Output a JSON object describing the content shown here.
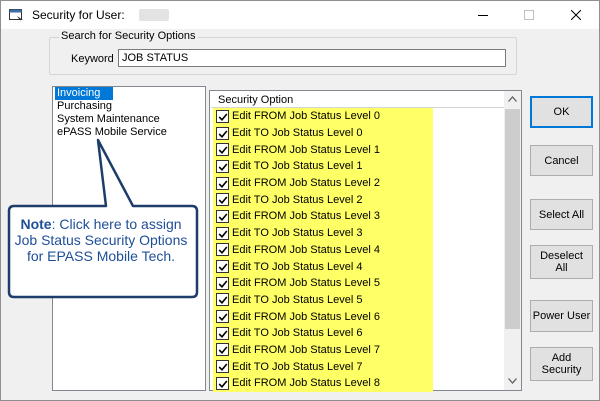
{
  "window": {
    "title": "Security for User:",
    "icon": "app-window-icon"
  },
  "search": {
    "group_label": "Search for Security Options",
    "keyword_label": "Keyword",
    "keyword_value": "JOB STATUS"
  },
  "modules": [
    {
      "label": "Invoicing",
      "selected": true
    },
    {
      "label": "Purchasing",
      "selected": false
    },
    {
      "label": "System Maintenance",
      "selected": false
    },
    {
      "label": "ePASS Mobile Service",
      "selected": false
    }
  ],
  "options": {
    "header": "Security Option",
    "highlight_color": "#ffff66",
    "rows": [
      {
        "label": "Edit FROM Job Status Level 0",
        "checked": true
      },
      {
        "label": "Edit TO Job Status Level 0",
        "checked": true
      },
      {
        "label": "Edit FROM Job Status Level 1",
        "checked": true
      },
      {
        "label": "Edit TO Job Status Level 1",
        "checked": true
      },
      {
        "label": "Edit FROM Job Status Level 2",
        "checked": true
      },
      {
        "label": "Edit TO Job Status Level 2",
        "checked": true
      },
      {
        "label": "Edit FROM Job Status Level 3",
        "checked": true
      },
      {
        "label": "Edit TO Job Status Level 3",
        "checked": true
      },
      {
        "label": "Edit FROM Job Status Level 4",
        "checked": true
      },
      {
        "label": "Edit TO Job Status Level 4",
        "checked": true
      },
      {
        "label": "Edit FROM Job Status Level 5",
        "checked": true
      },
      {
        "label": "Edit TO Job Status Level 5",
        "checked": true
      },
      {
        "label": "Edit FROM Job Status Level 6",
        "checked": true
      },
      {
        "label": "Edit TO Job Status Level 6",
        "checked": true
      },
      {
        "label": "Edit FROM Job Status Level 7",
        "checked": true
      },
      {
        "label": "Edit TO Job Status Level 7",
        "checked": true
      },
      {
        "label": "Edit FROM Job Status Level 8",
        "checked": true
      }
    ]
  },
  "buttons": {
    "ok": "OK",
    "cancel": "Cancel",
    "select_all": "Select All",
    "deselect_all": "Deselect\nAll",
    "power_user": "Power User",
    "add_security": "Add\nSecurity"
  },
  "callout": {
    "note_label": "Note",
    "note_text": ": Click here to assign Job Status Security Options for EPASS Mobile Tech.",
    "text_color": "#1f4e99",
    "border_color": "#1f3d6b"
  },
  "colors": {
    "selection": "#0078d7",
    "default_button_border": "#0078d7"
  }
}
